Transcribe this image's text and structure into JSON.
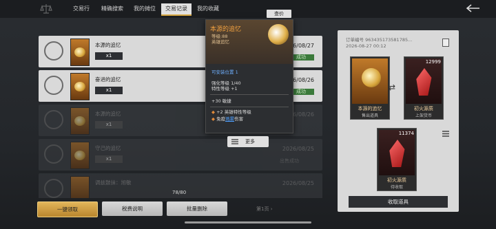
{
  "nav": {
    "tabs": [
      {
        "label": "交易行"
      },
      {
        "label": "精确搜索"
      },
      {
        "label": "我的摊位"
      },
      {
        "label": "交易记录"
      },
      {
        "label": "我的收藏"
      }
    ],
    "active_index": 3
  },
  "records": [
    {
      "name": "本源的追忆",
      "qty": "x1",
      "date": "2026/08/27",
      "status": "成功"
    },
    {
      "name": "奋进的追忆",
      "qty": "x1",
      "date": "2026/08/26",
      "status": "成功"
    },
    {
      "name": "本源的追忆",
      "qty": "x1",
      "date": "2026/08/26",
      "status": ""
    },
    {
      "name": "守己的追忆",
      "qty": "x1",
      "date": "2026/08/25",
      "status": "出售成功"
    },
    {
      "name": "调兹鼓抹：旭敏",
      "qty": "",
      "date": "2026/08/25",
      "status": ""
    }
  ],
  "counter": "78/80",
  "buttons": {
    "claim_all": "一键领取",
    "tax": "税费说明",
    "batch_delete": "批量删除",
    "page": "第1页"
  },
  "tooltip": {
    "price_button": "查价",
    "title": "本源的追忆",
    "level": "等级:88",
    "kind": "英雄追忆",
    "slot": "可安装位置 1",
    "enhance": "强化等级 1/40",
    "trait": "特性等级 +1",
    "stat": "+30 敏捷",
    "bonus1": "+2 英雄特性等级",
    "bonus2_pre": "免疫",
    "bonus2_link": "溅雾",
    "bonus2_post": "伤害",
    "more": "更多"
  },
  "detail": {
    "order_id_line1": "订单编号 963435173581785...",
    "order_id_line2": "2026-08-27 00:12",
    "item": {
      "name": "本源的追忆",
      "tag": "售出道具"
    },
    "currency": {
      "name": "初火源质",
      "tag": "上架货币",
      "amount": "12999"
    },
    "pending": {
      "name": "初火源质",
      "tag": "待收取",
      "amount": "11374"
    },
    "collect": "收取道具"
  },
  "colors": {
    "accent_gold": "#d6a640",
    "success_green": "#3b7a3b"
  }
}
